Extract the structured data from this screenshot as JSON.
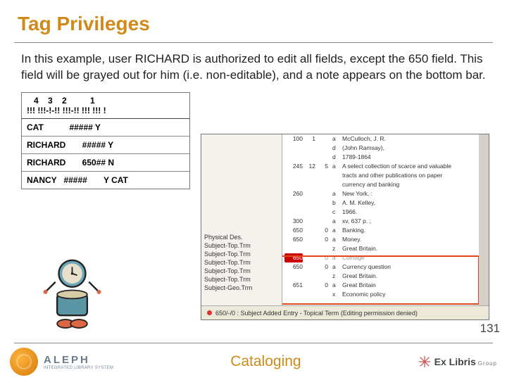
{
  "title": "Tag Privileges",
  "description": "In this example, user RICHARD is authorized to edit all fields, except the 650 field. This field will be grayed out for him (i.e. non-editable), and a note appears on the bottom bar.",
  "priv_table": {
    "header": "   4    3    2          1\n!!! !!!-!-!! !!!-!! !!! !!! !",
    "rows": [
      {
        "user": "CAT",
        "tag": "",
        "sub": "#####",
        "flag": "Y",
        "extra": ""
      },
      {
        "user": "RICHARD",
        "tag": "",
        "sub": "#####",
        "flag": "Y",
        "extra": ""
      },
      {
        "user": "RICHARD",
        "tag": "",
        "sub": "650##",
        "flag": "N",
        "extra": ""
      },
      {
        "user": "NANCY",
        "tag": "#####",
        "sub": "",
        "flag": "Y",
        "extra": "CAT"
      }
    ]
  },
  "record_left": [
    "Physical Des.",
    "Subject-Top.Trm",
    "Subject-Top.Trm",
    "Subject-Top.Trm",
    "Subject-Top.Trm",
    "Subject-Top.Trm",
    "Subject-Geo.Trm"
  ],
  "record_lines": [
    {
      "n": "100",
      "a": "1",
      "b": "",
      "c": "a",
      "t": "McCulloch, J. R."
    },
    {
      "n": "",
      "a": "",
      "b": "",
      "c": "d",
      "t": "(John Ramsay),"
    },
    {
      "n": "",
      "a": "",
      "b": "",
      "c": "d",
      "t": "1789-1864"
    },
    {
      "n": "245",
      "a": "12",
      "b": "5",
      "c": "a",
      "t": "A select collection of scarce and valuable"
    },
    {
      "n": "",
      "a": "",
      "b": "",
      "c": "",
      "t": "tracts and other publications on paper"
    },
    {
      "n": "",
      "a": "",
      "b": "",
      "c": "",
      "t": "currency and banking"
    },
    {
      "n": "260",
      "a": "",
      "b": "",
      "c": "a",
      "t": "New York, :"
    },
    {
      "n": "",
      "a": "",
      "b": "",
      "c": "b",
      "t": "A. M. Kelley,"
    },
    {
      "n": "",
      "a": "",
      "b": "",
      "c": "c",
      "t": "1966."
    },
    {
      "n": "300",
      "a": "",
      "b": "",
      "c": "a",
      "t": "xv, 637 p. ;"
    },
    {
      "n": "650",
      "a": "",
      "b": "0",
      "c": "a",
      "t": "Banking."
    },
    {
      "n": "650",
      "a": "",
      "b": "0",
      "c": "a",
      "t": "Money."
    },
    {
      "n": "",
      "a": "",
      "b": "",
      "c": "z",
      "t": "Great Britain."
    },
    {
      "n": "650",
      "a": "",
      "b": "0",
      "c": "a",
      "t": "Coinage",
      "gray": true
    },
    {
      "n": "650",
      "a": "",
      "b": "0",
      "c": "a",
      "t": "Currency question"
    },
    {
      "n": "",
      "a": "",
      "b": "",
      "c": "z",
      "t": "Great Britain."
    },
    {
      "n": "651",
      "a": "",
      "b": "0",
      "c": "a",
      "t": "Great Britain"
    },
    {
      "n": "",
      "a": "",
      "b": "",
      "c": "x",
      "t": "Economic policy"
    }
  ],
  "status_bar": "650/-/0 : Subject Added Entry - Topical Term (Editing permission denied)",
  "page_number": "131",
  "footer": {
    "logo_name": "ALEPH",
    "logo_sub": "INTEGRATED LIBRARY SYSTEM",
    "center": "Cataloging",
    "right_brand": "Ex Libris",
    "right_suffix": "Group"
  }
}
